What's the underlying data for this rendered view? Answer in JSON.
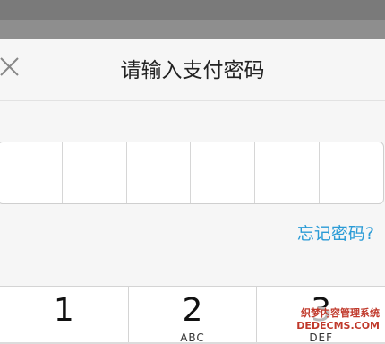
{
  "header": {
    "title": "请输入支付密码"
  },
  "close": {
    "icon": "close-icon"
  },
  "pin": {
    "length": 6
  },
  "forgot_link": "忘记密码?",
  "keypad": {
    "keys": [
      {
        "num": "1",
        "letters": ""
      },
      {
        "num": "2",
        "letters": "ABC"
      },
      {
        "num": "3",
        "letters": "DEF"
      }
    ]
  },
  "watermark": {
    "line1": "织梦内容管理系统",
    "line2": "DEDECMS.COM"
  },
  "colors": {
    "link": "#2a9bd6",
    "title": "#222222"
  }
}
